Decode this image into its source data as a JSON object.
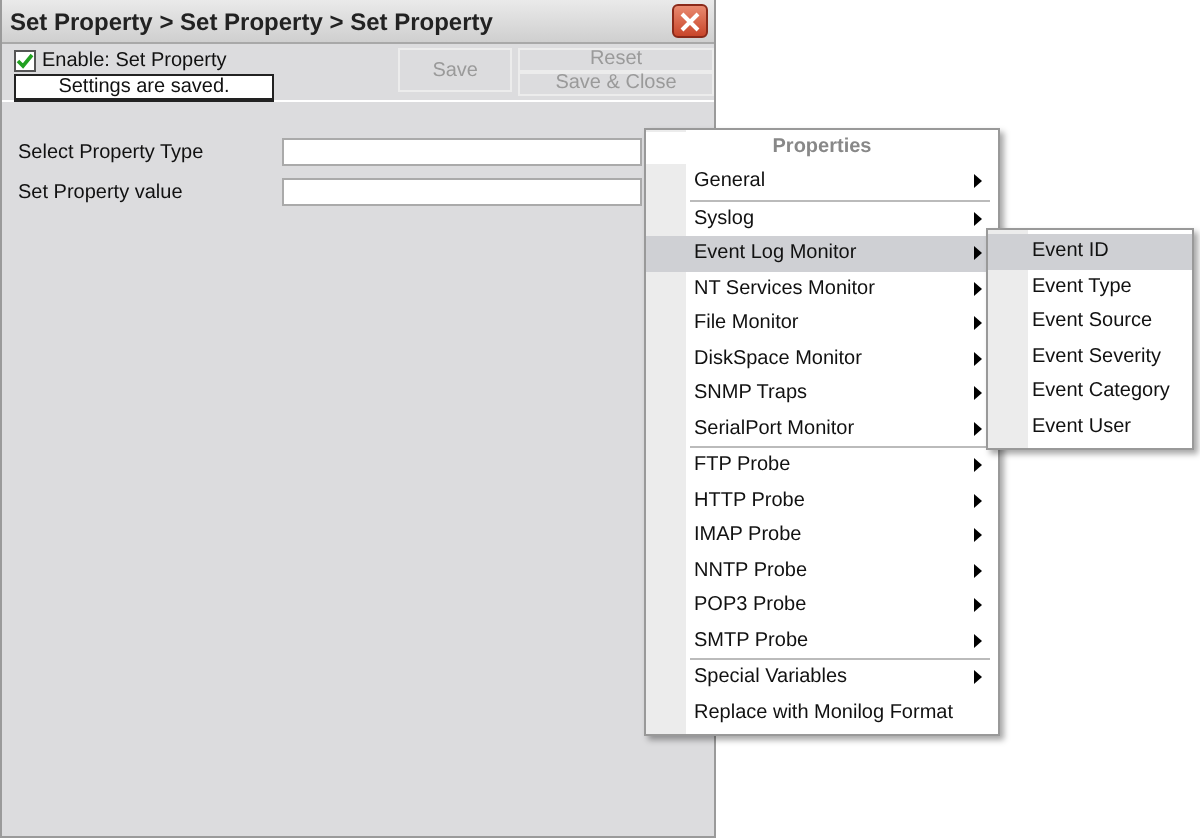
{
  "window": {
    "title": "Set Property > Set Property > Set Property"
  },
  "enable": {
    "label": "Enable: Set Property",
    "checked": true
  },
  "status": "Settings are saved.",
  "buttons": [
    {
      "label": "Save",
      "disabled": true
    },
    {
      "label": "Reset",
      "disabled": true
    },
    {
      "label": "Save & Close",
      "disabled": true
    }
  ],
  "fields": [
    {
      "label": "Select Property Type"
    },
    {
      "label": "Set Property value"
    }
  ],
  "menu": {
    "title": "Properties",
    "groups": [
      [
        {
          "label": "General",
          "submenu": true,
          "selected": false
        }
      ],
      [
        {
          "label": "Syslog",
          "submenu": true,
          "selected": false
        },
        {
          "label": "Event Log Monitor",
          "submenu": true,
          "selected": true
        },
        {
          "label": "NT Services Monitor",
          "submenu": true,
          "selected": false
        },
        {
          "label": "File Monitor",
          "submenu": true,
          "selected": false
        },
        {
          "label": "DiskSpace Monitor",
          "submenu": true,
          "selected": false
        },
        {
          "label": "SNMP Traps",
          "submenu": true,
          "selected": false
        },
        {
          "label": "SerialPort Monitor",
          "submenu": true,
          "selected": false
        }
      ],
      [
        {
          "label": "FTP Probe",
          "submenu": true,
          "selected": false
        },
        {
          "label": "HTTP Probe",
          "submenu": true,
          "selected": false
        },
        {
          "label": "IMAP Probe",
          "submenu": true,
          "selected": false
        },
        {
          "label": "NNTP Probe",
          "submenu": true,
          "selected": false
        },
        {
          "label": "POP3 Probe",
          "submenu": true,
          "selected": false
        },
        {
          "label": "SMTP Probe",
          "submenu": true,
          "selected": false
        }
      ],
      [
        {
          "label": "Special Variables",
          "submenu": true,
          "selected": false
        },
        {
          "label": "Replace with Monilog Format",
          "submenu": false,
          "selected": false
        }
      ]
    ]
  },
  "submenu": [
    {
      "label": "Event ID",
      "selected": true
    },
    {
      "label": "Event Type",
      "selected": false
    },
    {
      "label": "Event Source",
      "selected": false
    },
    {
      "label": "Event Severity",
      "selected": false
    },
    {
      "label": "Event Category",
      "selected": false
    },
    {
      "label": "Event User",
      "selected": false
    }
  ]
}
